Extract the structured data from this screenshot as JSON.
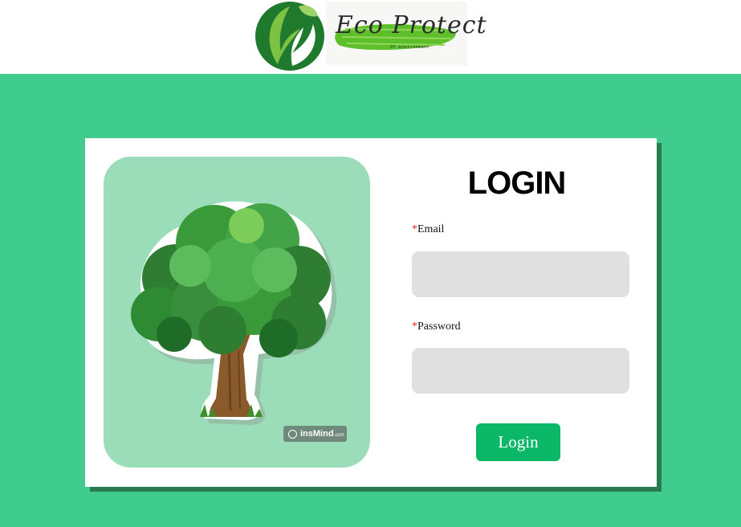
{
  "header": {
    "logo_name": "Eco Protect",
    "logo_tagline": "Of environment",
    "colors": {
      "leaf_dark": "#1f7a2e",
      "leaf_light": "#7cc243",
      "brush": "#5fbf2b"
    }
  },
  "login": {
    "title": "LOGIN",
    "email_required_mark": "*",
    "email_label": "Email",
    "email_value": "",
    "password_required_mark": "*",
    "password_label": "Password",
    "password_value": "",
    "submit_label": "Login"
  },
  "illustration": {
    "subject": "tree-illustration",
    "watermark_text": "insMind",
    "watermark_suffix": ".com"
  },
  "colors": {
    "page_bg": "#40cc8f",
    "card_bg": "#ffffff",
    "card_shadow": "#2a7b50",
    "panel_bg": "#9bdcb9",
    "input_bg": "#e0e0e0",
    "button_bg": "#0ab868",
    "required": "#e5252a"
  }
}
